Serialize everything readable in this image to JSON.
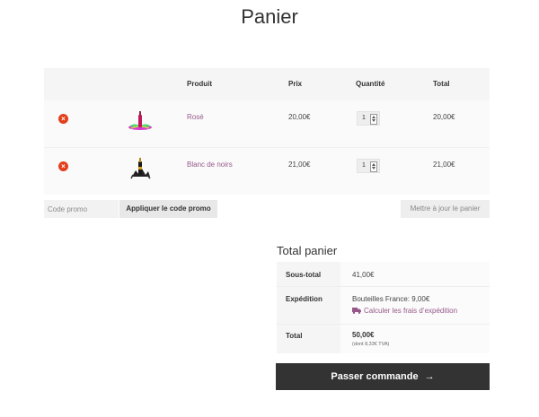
{
  "page": {
    "title": "Panier"
  },
  "cart": {
    "columns": {
      "product": "Produit",
      "price": "Prix",
      "quantity": "Quantité",
      "total": "Total"
    },
    "items": [
      {
        "name": "Rosé",
        "price": "20,00€",
        "quantity": "1",
        "subtotal": "20,00€",
        "remove_glyph": "×",
        "thumb_icon": "rose-wine-bottle-icon"
      },
      {
        "name": "Blanc de noirs",
        "price": "21,00€",
        "quantity": "1",
        "subtotal": "21,00€",
        "remove_glyph": "×",
        "thumb_icon": "blanc-de-noirs-bottle-icon"
      }
    ]
  },
  "actions": {
    "coupon_placeholder": "Code promo",
    "apply_coupon": "Appliquer le code promo",
    "update_cart": "Mettre à jour le panier"
  },
  "totals": {
    "title": "Total panier",
    "subtotal_label": "Sous-total",
    "subtotal_value": "41,00€",
    "shipping_label": "Expédition",
    "shipping_value": "Bouteilles France: 9,00€",
    "shipping_calc_link": "Calculer les frais d’expédition",
    "total_label": "Total",
    "total_value": "50,00€",
    "tax_note": "(dont 8,33€ TVA)"
  },
  "checkout": {
    "label": "Passer commande",
    "arrow": "→"
  },
  "colors": {
    "accent": "#96588a",
    "remove": "#e2401c",
    "checkout_bg": "#333333"
  }
}
